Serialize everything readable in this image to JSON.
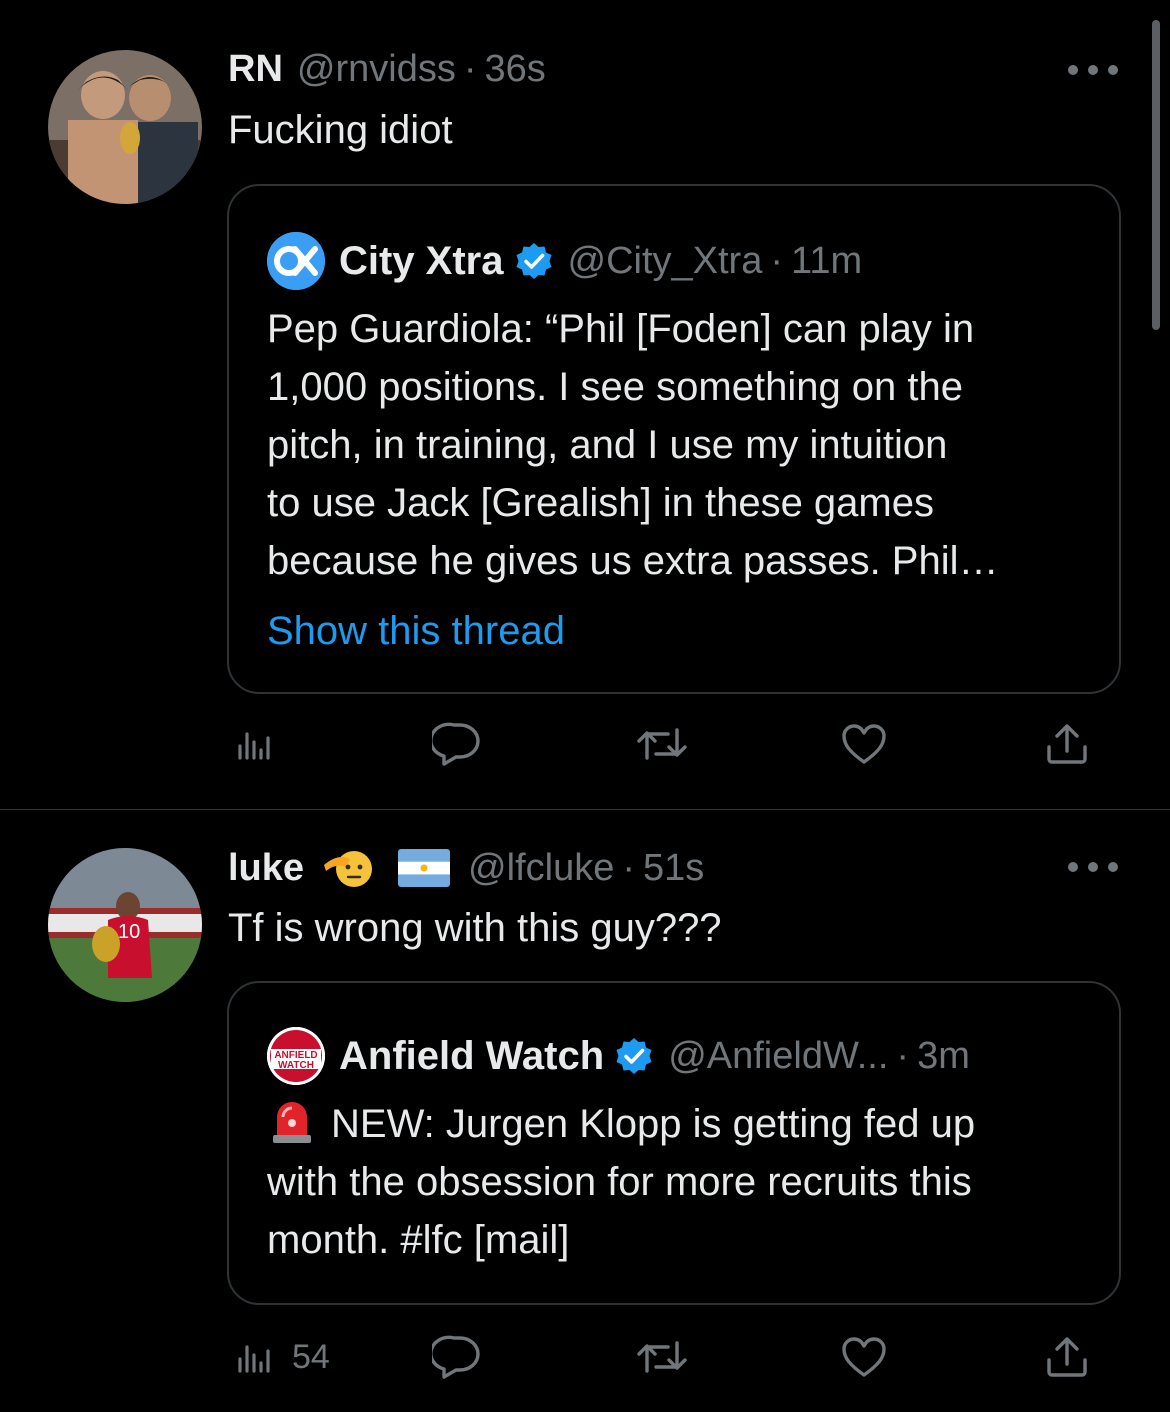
{
  "tweets": [
    {
      "name": "RN",
      "handle": "@rnvidss",
      "separator": "·",
      "time": "36s",
      "text": "Fucking idiot",
      "quote": {
        "name": "City Xtra",
        "handle": "@City_Xtra",
        "separator": "·",
        "time": "11m",
        "logo": "cityxtra-logo",
        "lines": [
          "Pep Guardiola: “Phil [Foden] can play in",
          "1,000 positions. I see something on the",
          "pitch, in training, and I use my intuition",
          "to use Jack [Grealish] in these games",
          "because he gives us extra passes. Phil…"
        ],
        "show_thread": "Show this thread"
      },
      "actions": {
        "views": "",
        "replies": "",
        "retweets": "",
        "likes": ""
      }
    },
    {
      "name": "luke",
      "emoji": [
        "saluting-face",
        "argentina-flag"
      ],
      "handle": "@lfcluke",
      "separator": "·",
      "time": "51s",
      "text": "Tf is wrong with this guy???",
      "quote": {
        "name": "Anfield Watch",
        "handle": "@AnfieldW...",
        "separator": "·",
        "time": "3m",
        "logo": "anfield-watch-logo",
        "logo_text": [
          "ANFIELD",
          "WATCH"
        ],
        "lines": [
          "NEW: Jurgen Klopp is getting fed up",
          "with the obsession for more recruits this",
          "month. #lfc [mail]"
        ]
      },
      "actions": {
        "views": "54",
        "replies": "",
        "retweets": "",
        "likes": ""
      }
    }
  ],
  "colors": {
    "background": "#000000",
    "text": "#e7e9ea",
    "muted": "#71767b",
    "link": "#1d9bf0",
    "border": "#2f3336",
    "verified": "#1d9bf0"
  },
  "icons": [
    "more-icon",
    "views-icon",
    "reply-icon",
    "retweet-icon",
    "like-icon",
    "share-icon",
    "verified-badge-icon",
    "siren-emoji-icon"
  ]
}
